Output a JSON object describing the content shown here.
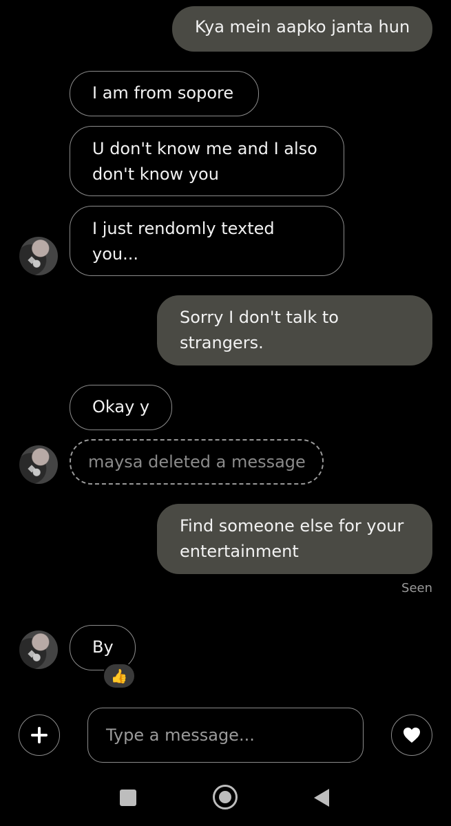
{
  "messages": [
    {
      "id": "m1",
      "text": "Kya mein aapko janta hun",
      "side": "sent"
    },
    {
      "id": "m2",
      "text": "I am from sopore",
      "side": "received"
    },
    {
      "id": "m3",
      "line1": "U don't know me and I also",
      "line2": "don't know you",
      "side": "received"
    },
    {
      "id": "m4",
      "line1": "I just rendomly texted",
      "line2": "you...",
      "side": "received"
    },
    {
      "id": "m5",
      "line1": "Sorry I don't talk to",
      "line2": "strangers.",
      "side": "sent"
    },
    {
      "id": "m6",
      "text": "Okay y",
      "side": "received"
    },
    {
      "id": "m7",
      "text": "maysa deleted a message",
      "side": "received",
      "deleted": true
    },
    {
      "id": "m8",
      "line1": "Find someone else for your",
      "line2": "entertainment",
      "side": "sent"
    },
    {
      "id": "m9",
      "text": "By",
      "side": "received",
      "reaction": "👍"
    }
  ],
  "status": {
    "seen": "Seen"
  },
  "composer": {
    "placeholder": "Type a message..."
  },
  "icons": {
    "add": "plus-icon",
    "like": "heart-icon"
  },
  "colors": {
    "background": "#000000",
    "sent_bubble": "#4a4a44",
    "received_border": "#8d8d8d"
  }
}
